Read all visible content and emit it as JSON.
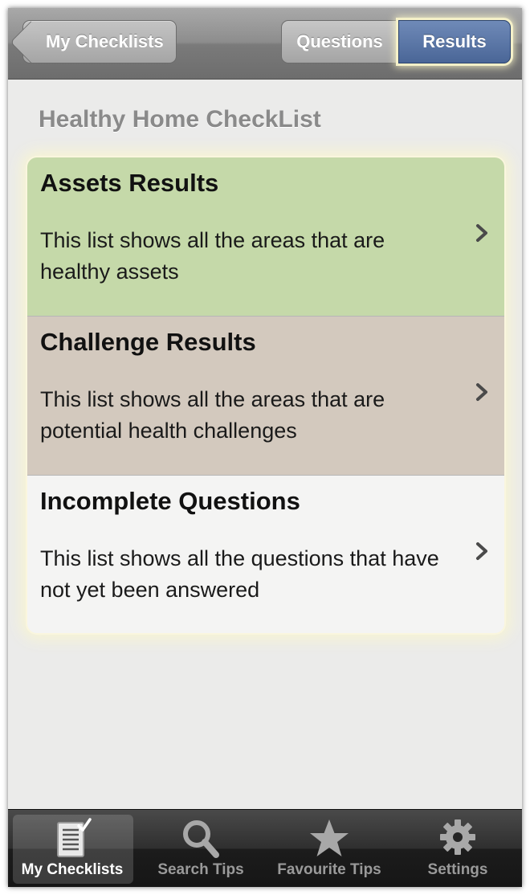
{
  "navbar": {
    "back_label": "My Checklists",
    "segments": [
      {
        "label": "Questions",
        "selected": false
      },
      {
        "label": "Results",
        "selected": true
      }
    ]
  },
  "page": {
    "title": "Healthy Home CheckList"
  },
  "results_list": [
    {
      "title": "Assets Results",
      "description": "This list shows all the areas that are healthy assets",
      "color": "#c5d9a9"
    },
    {
      "title": "Challenge Results",
      "description": "This list shows all the areas that are potential health challenges",
      "color": "#d3c9be"
    },
    {
      "title": "Incomplete Questions",
      "description": "This list shows all the questions that have not yet been answered",
      "color": "#f4f4f3"
    }
  ],
  "tabbar": {
    "tabs": [
      {
        "label": "My Checklists",
        "icon": "checklist-icon",
        "selected": true
      },
      {
        "label": "Search Tips",
        "icon": "search-icon",
        "selected": false
      },
      {
        "label": "Favourite Tips",
        "icon": "star-icon",
        "selected": false
      },
      {
        "label": "Settings",
        "icon": "gear-icon",
        "selected": false
      }
    ]
  },
  "colors": {
    "selected_segment": "#4a6697",
    "title_gray": "#8a8a8a"
  }
}
